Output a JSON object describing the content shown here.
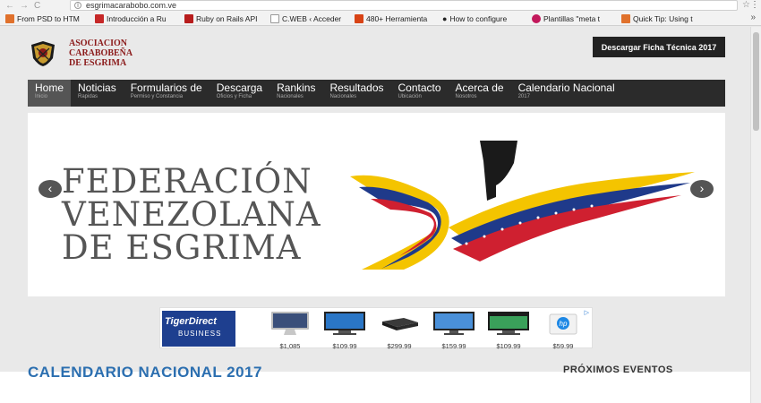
{
  "browser": {
    "url": "esgrimacarabobo.com.ve",
    "bookmarks": [
      {
        "label": "From PSD to HTM",
        "color": "#e0712c"
      },
      {
        "label": "Introducción a Ru",
        "color": "#c62828"
      },
      {
        "label": "Ruby on Rails API",
        "color": "#b71c1c"
      },
      {
        "label": "C.WEB ‹ Acceder",
        "color": "#888888"
      },
      {
        "label": "480+ Herramienta",
        "color": "#d84315"
      },
      {
        "label": "How to configure",
        "color": "#333333"
      },
      {
        "label": "Plantillas \"meta t",
        "color": "#c2185b"
      },
      {
        "label": "Quick Tip: Using t",
        "color": "#e0712c"
      }
    ]
  },
  "header": {
    "logo_text": [
      "ASOCIACION",
      "CARABOBEÑA",
      "DE ESGRIMA"
    ],
    "download_button": "Descargar Ficha Técnica 2017"
  },
  "nav": [
    {
      "label": "Home",
      "sub": "Inicio",
      "active": true
    },
    {
      "label": "Noticias",
      "sub": "Rapidas"
    },
    {
      "label": "Formularios de",
      "sub": "Permiso y Constancia"
    },
    {
      "label": "Descarga",
      "sub": "Oficios y Ficha"
    },
    {
      "label": "Rankins",
      "sub": "Nacionales"
    },
    {
      "label": "Resultados",
      "sub": "Nacionales"
    },
    {
      "label": "Contacto",
      "sub": "Ubicación"
    },
    {
      "label": "Acerca de",
      "sub": "Nosotros"
    },
    {
      "label": "Calendario Nacional",
      "sub": "2017"
    }
  ],
  "slider": {
    "lines": [
      "FEDERACIÓN",
      "VENEZOLANA",
      "DE ESGRIMA"
    ]
  },
  "ad": {
    "brand_line1": "TigerDirect",
    "brand_line2": "BUSINESS",
    "adchoice": "▷",
    "items": [
      {
        "price": "$1,085",
        "icon": "imac-icon"
      },
      {
        "price": "$109.99",
        "icon": "monitor-icon"
      },
      {
        "price": "$299.99",
        "icon": "mini-pc-icon"
      },
      {
        "price": "$159.99",
        "icon": "monitor-icon"
      },
      {
        "price": "$109.99",
        "icon": "planar-monitor-icon"
      },
      {
        "price": "$59.99",
        "icon": "hp-printer-icon"
      }
    ]
  },
  "content": {
    "calendar_title": "CALENDARIO NACIONAL 2017",
    "events_title": "PRÓXIMOS EVENTOS"
  }
}
